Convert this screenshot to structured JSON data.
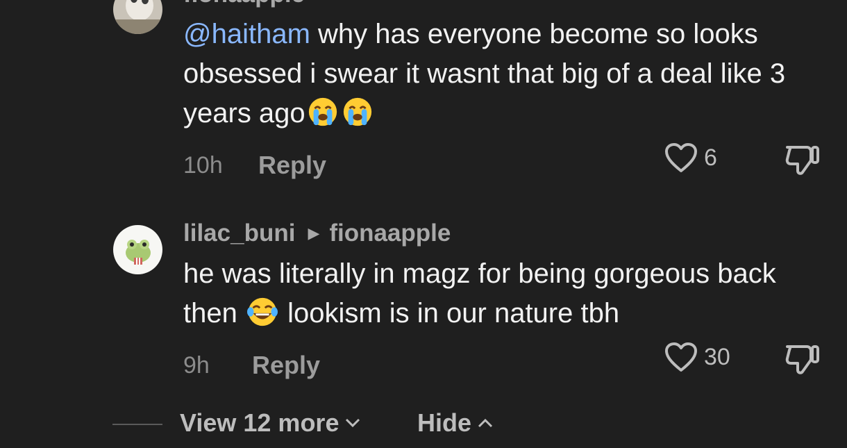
{
  "comments": [
    {
      "username": "fionaapple",
      "mention": "@haitham",
      "text": " why has everyone become so looks obsessed i swear it wasnt that big of a deal like 3 years ago",
      "time": "10h",
      "reply_label": "Reply",
      "likes": "6",
      "emoji": "loudly-crying-face"
    },
    {
      "username": "lilac_buni",
      "reply_to": "fionaapple",
      "text_before": "he was literally in magz for being gorgeous back then ",
      "text_after": " lookism is in our nature tbh",
      "time": "9h",
      "reply_label": "Reply",
      "likes": "30",
      "emoji": "face-with-tears-of-joy"
    }
  ],
  "footer": {
    "view_more": "View 12 more",
    "hide": "Hide"
  },
  "colors": {
    "background": "#1f1f1f",
    "mention": "#8ab8ff",
    "text": "#f2f2f2",
    "muted": "#8c8c8c"
  }
}
